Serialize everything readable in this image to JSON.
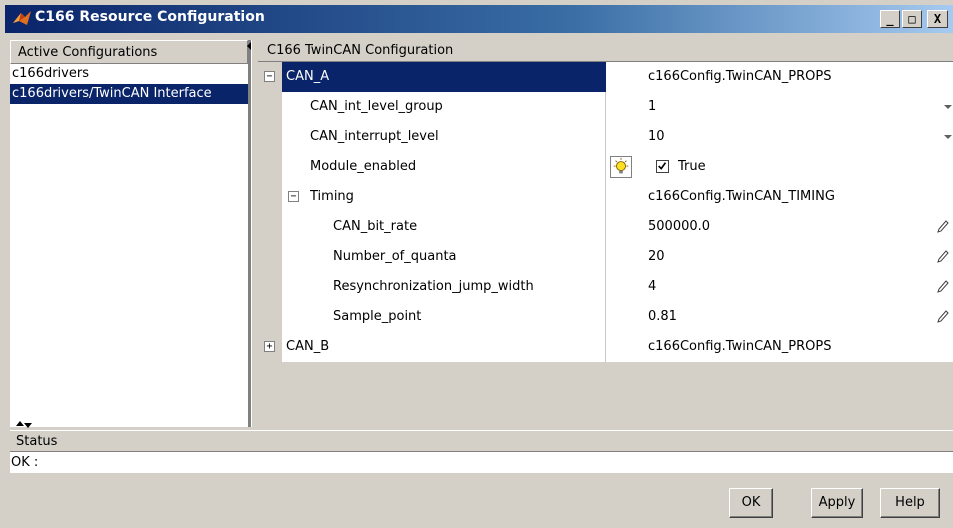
{
  "window": {
    "title": "C166 Resource Configuration",
    "controls": {
      "minimize": "_",
      "maximize": "□",
      "close": "X"
    }
  },
  "left_panel": {
    "header": "Active Configurations",
    "items": [
      {
        "label": "c166drivers",
        "selected": false
      },
      {
        "label": "c166drivers/TwinCAN Interface",
        "selected": true
      }
    ]
  },
  "right_panel": {
    "header": "C166 TwinCAN Configuration",
    "rows": [
      {
        "name": "CAN_A",
        "value": "c166Config.TwinCAN_PROPS",
        "expander": "−",
        "indent": 0
      },
      {
        "name": "CAN_int_level_group",
        "value": "1",
        "indent": 1,
        "control": "dropdown"
      },
      {
        "name": "CAN_interrupt_level",
        "value": "10",
        "indent": 1,
        "control": "dropdown"
      },
      {
        "name": "Module_enabled",
        "value": "True",
        "indent": 1,
        "control": "checkbox",
        "checked": true
      },
      {
        "name": "Timing",
        "value": "c166Config.TwinCAN_TIMING",
        "expander": "−",
        "indent": 1
      },
      {
        "name": "CAN_bit_rate",
        "value": "500000.0",
        "indent": 2,
        "control": "edit"
      },
      {
        "name": "Number_of_quanta",
        "value": "20",
        "indent": 2,
        "control": "edit"
      },
      {
        "name": "Resynchronization_jump_width",
        "value": "4",
        "indent": 2,
        "control": "edit"
      },
      {
        "name": "Sample_point",
        "value": "0.81",
        "indent": 2,
        "control": "edit"
      },
      {
        "name": "CAN_B",
        "value": "c166Config.TwinCAN_PROPS",
        "expander": "+",
        "indent": 0
      }
    ]
  },
  "status": {
    "header": "Status",
    "text": "OK :"
  },
  "buttons": {
    "ok": "OK",
    "apply": "Apply",
    "help": "Help"
  }
}
